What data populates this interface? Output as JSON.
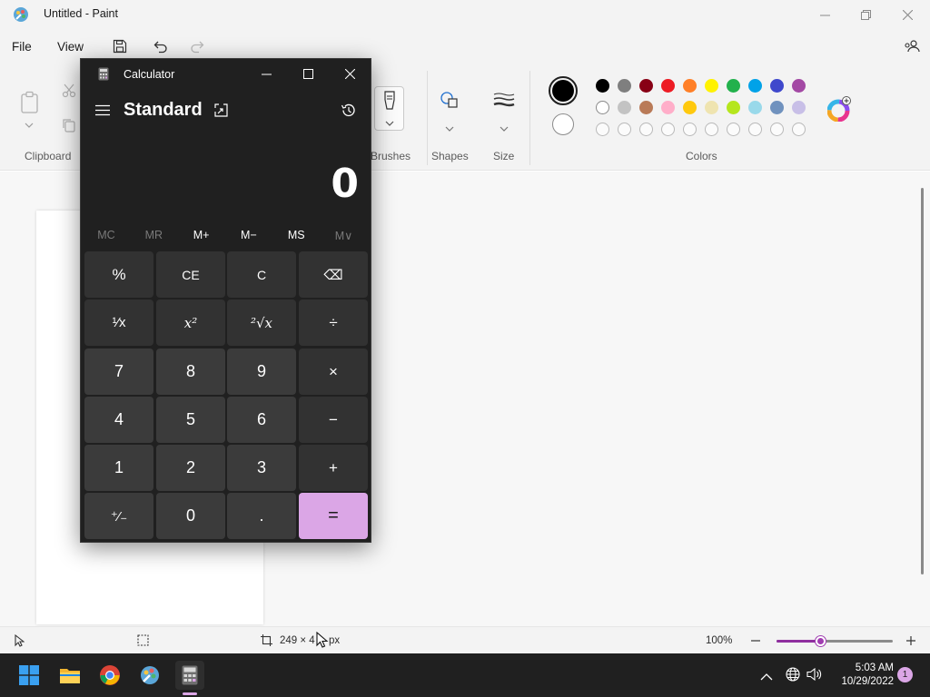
{
  "paint": {
    "title": "Untitled - Paint",
    "menu": {
      "file": "File",
      "view": "View"
    },
    "ribbon": {
      "groups": {
        "clipboard": "Clipboard",
        "brushes": "Brushes",
        "shapes": "Shapes",
        "size": "Size",
        "colors": "Colors"
      },
      "primary_color": "#000000",
      "secondary_color": "#ffffff",
      "palette_row1": [
        "#000000",
        "#7f7f7f",
        "#880015",
        "#ed1c24",
        "#ff7f27",
        "#fff200",
        "#22b14c",
        "#00a2e8",
        "#3f48cc",
        "#a349a4"
      ],
      "palette_row2": [
        "#ffffff",
        "#c3c3c3",
        "#b97a57",
        "#ffaec9",
        "#ffc90e",
        "#efe4b0",
        "#b5e61d",
        "#99d9ea",
        "#7092be",
        "#c8bfe7"
      ],
      "palette_row3_empty_count": 10
    },
    "status": {
      "selection_size": "249 × 4",
      "unit": "px",
      "zoom": "100%",
      "zoom_fraction": 0.38
    }
  },
  "calculator": {
    "title": "Calculator",
    "mode": "Standard",
    "display": "0",
    "memory": [
      {
        "label": "MC",
        "enabled": false
      },
      {
        "label": "MR",
        "enabled": false
      },
      {
        "label": "M+",
        "enabled": true
      },
      {
        "label": "M−",
        "enabled": true
      },
      {
        "label": "MS",
        "enabled": true
      },
      {
        "label": "M∨",
        "enabled": false
      }
    ],
    "keys": {
      "percent": "%",
      "ce": "CE",
      "c": "C",
      "backspace": "⌫",
      "reciprocal": "¹⁄x",
      "square": "x²",
      "sqrt": "²√x",
      "divide": "÷",
      "n7": "7",
      "n8": "8",
      "n9": "9",
      "multiply": "×",
      "n4": "4",
      "n5": "5",
      "n6": "6",
      "minus": "−",
      "n1": "1",
      "n2": "2",
      "n3": "3",
      "plus": "+",
      "negate": "⁺⁄₋",
      "n0": "0",
      "decimal": ".",
      "equals": "="
    },
    "accent": "#dba6e6"
  },
  "taskbar": {
    "time": "5:03 AM",
    "date": "10/29/2022",
    "notification_count": "1"
  }
}
